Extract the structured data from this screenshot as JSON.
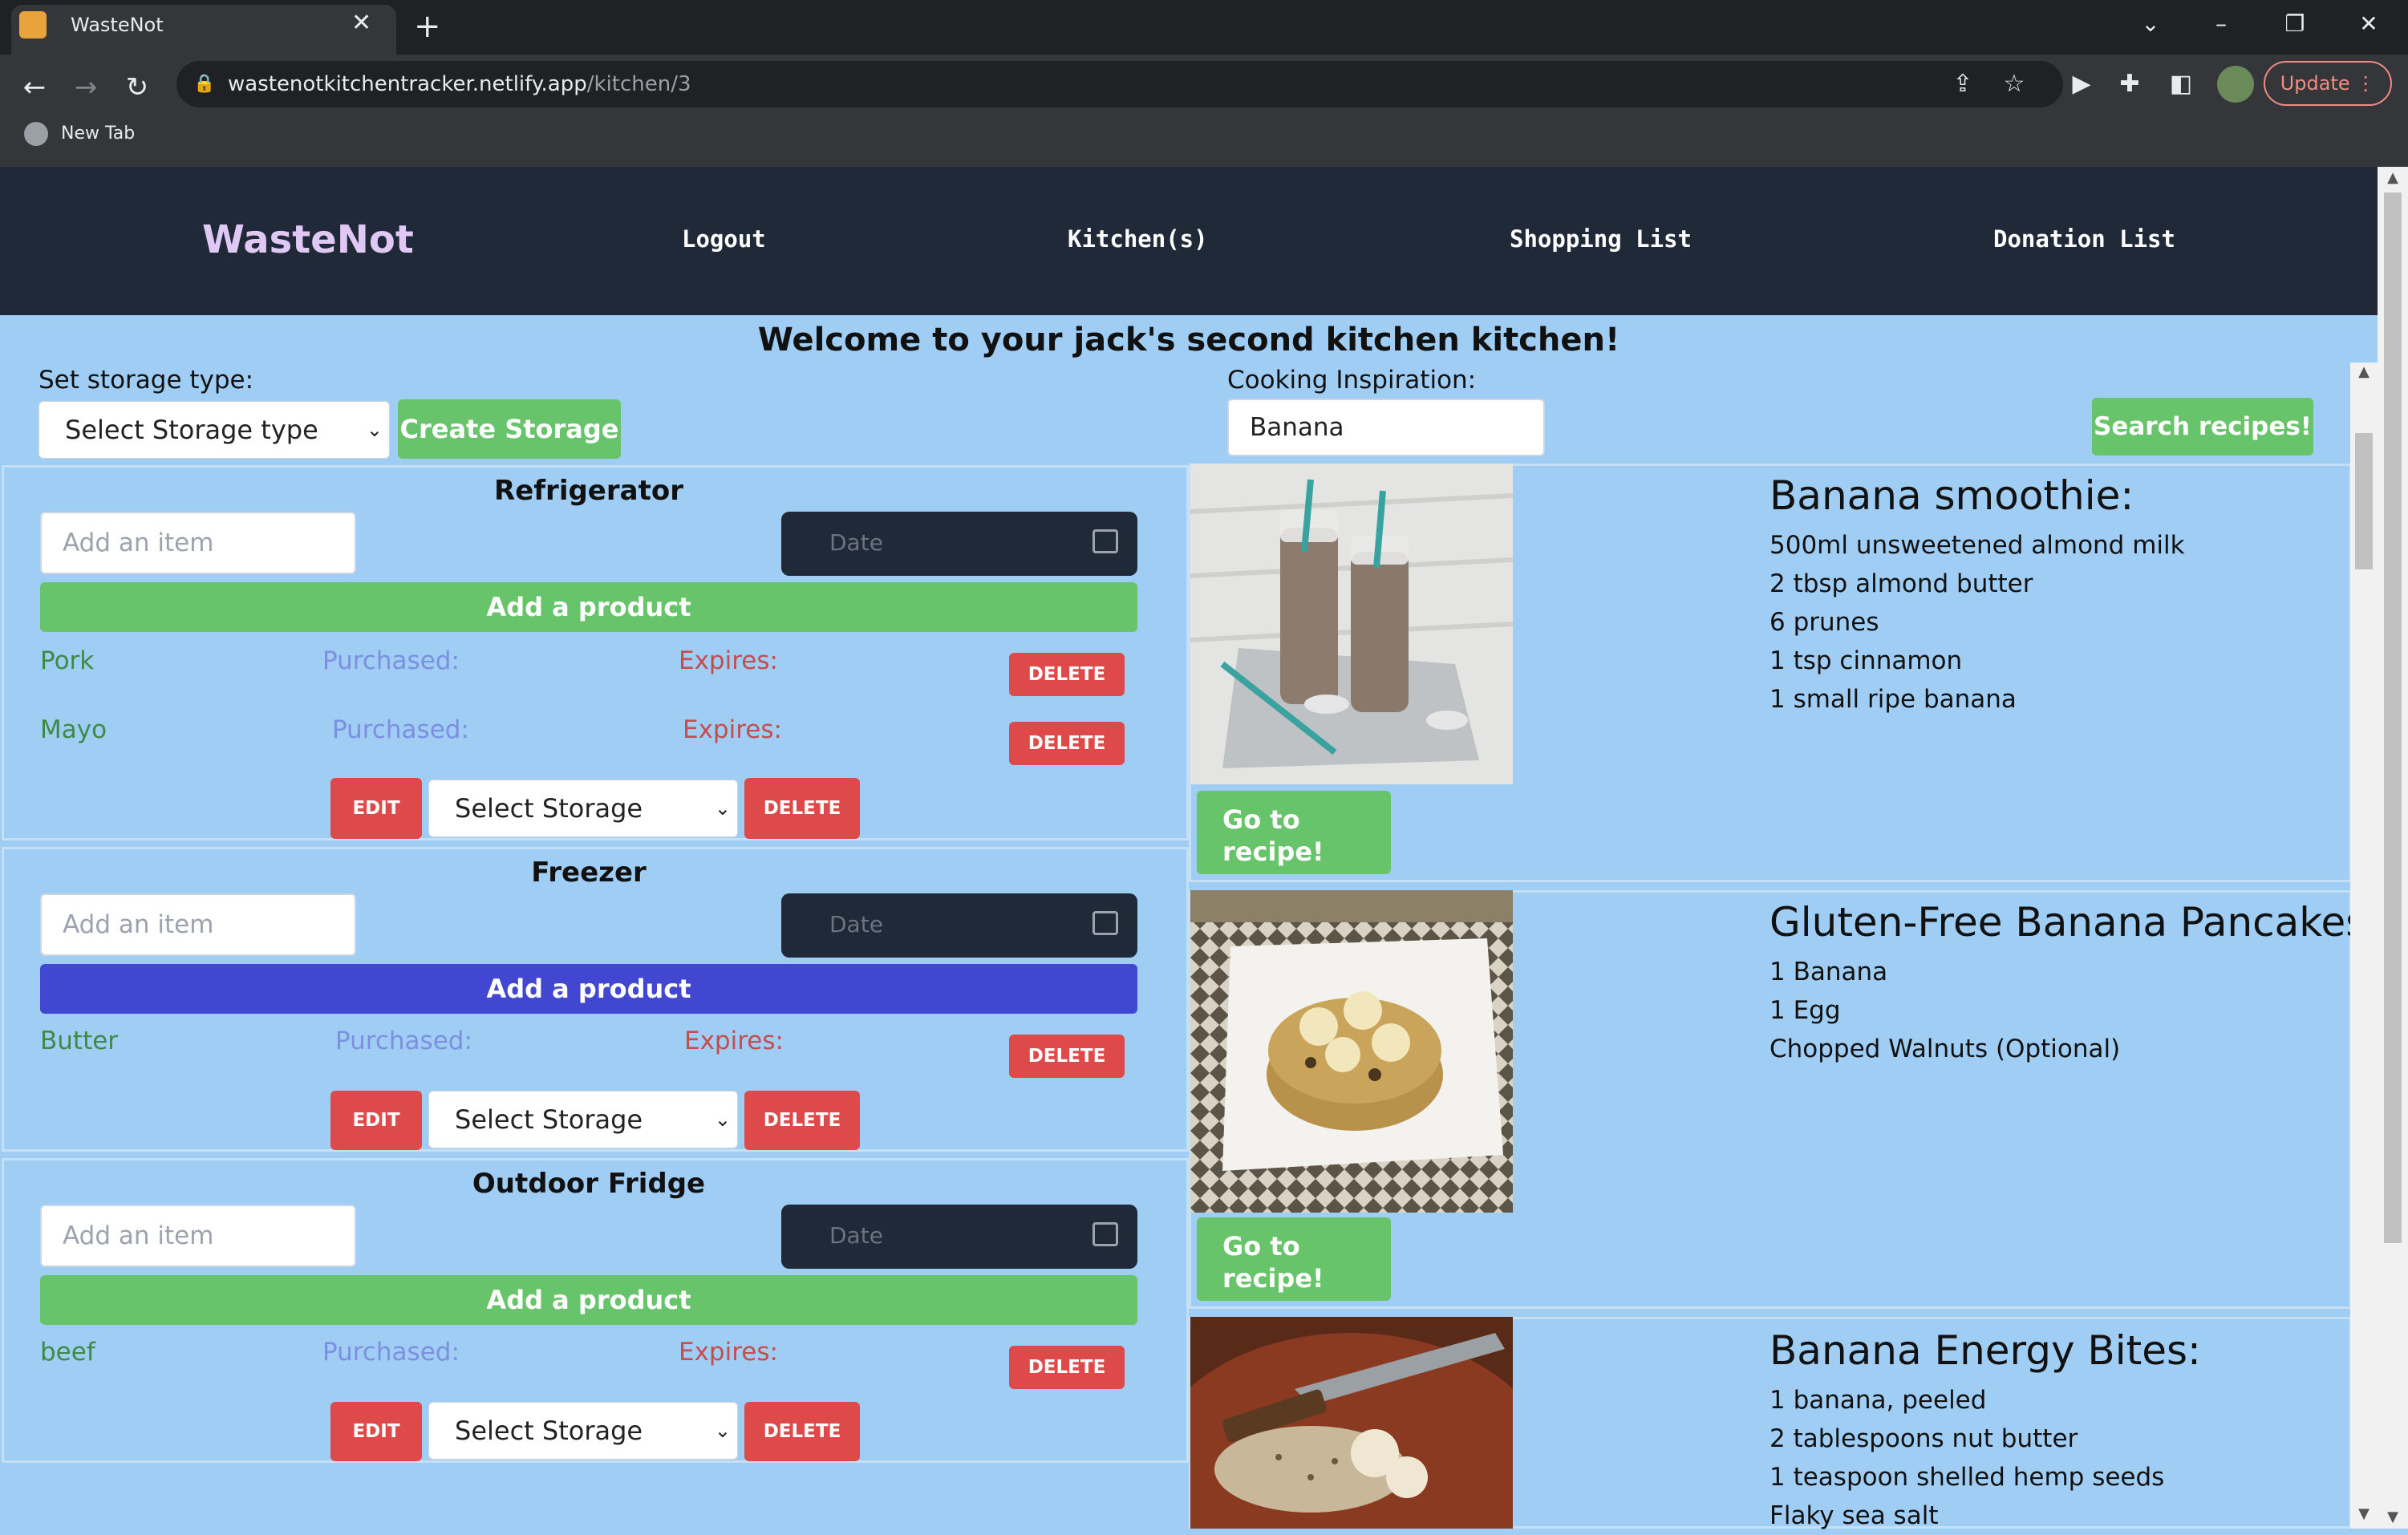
{
  "browser": {
    "tab_title": "WasteNot",
    "tab_close": "✕",
    "new_tab": "+",
    "url_host": "wastenotkitchentracker.netlify.app",
    "url_path": "/kitchen/3",
    "update_label": "Update",
    "bookmark_label": "New Tab"
  },
  "nav": {
    "logo": "WasteNot",
    "links": [
      "Logout",
      "Kitchen(s)",
      "Shopping List",
      "Donation List"
    ]
  },
  "welcome": "Welcome to your jack's second kitchen kitchen!",
  "storage_controls": {
    "label": "Set storage type:",
    "select_value": "Select Storage type",
    "create_button": "Create Storage"
  },
  "inspiration": {
    "label": "Cooking Inspiration:",
    "input_value": "Banana",
    "search_button": "Search recipes!"
  },
  "common": {
    "add_item_placeholder": "Add an item",
    "date_placeholder": "Date",
    "add_product": "Add a product",
    "purchased": "Purchased:",
    "expires": "Expires:",
    "delete": "DELETE",
    "edit": "EDIT",
    "select_storage": "Select Storage",
    "go_to_recipe": "Go to recipe!"
  },
  "storages": [
    {
      "name": "Refrigerator",
      "button_color": "#68c46a",
      "items": [
        "Pork",
        "Mayo"
      ]
    },
    {
      "name": "Freezer",
      "button_color": "#4247d2",
      "items": [
        "Butter"
      ]
    },
    {
      "name": "Outdoor Fridge",
      "button_color": "#68c46a",
      "items": [
        "beef"
      ]
    }
  ],
  "recipes": [
    {
      "title": "Banana smoothie:",
      "ingredients": [
        "500ml unsweetened almond milk",
        "2 tbsp almond butter",
        "6 prunes",
        "1 tsp cinnamon",
        "1 small ripe banana"
      ]
    },
    {
      "title": "Gluten-Free Banana Pancakes:",
      "ingredients": [
        "1 Banana",
        "1 Egg",
        "Chopped Walnuts (Optional)"
      ]
    },
    {
      "title": "Banana Energy Bites:",
      "ingredients": [
        "1 banana, peeled",
        "2 tablespoons nut butter",
        "1 teaspoon shelled hemp seeds",
        "Flaky sea salt"
      ]
    }
  ]
}
